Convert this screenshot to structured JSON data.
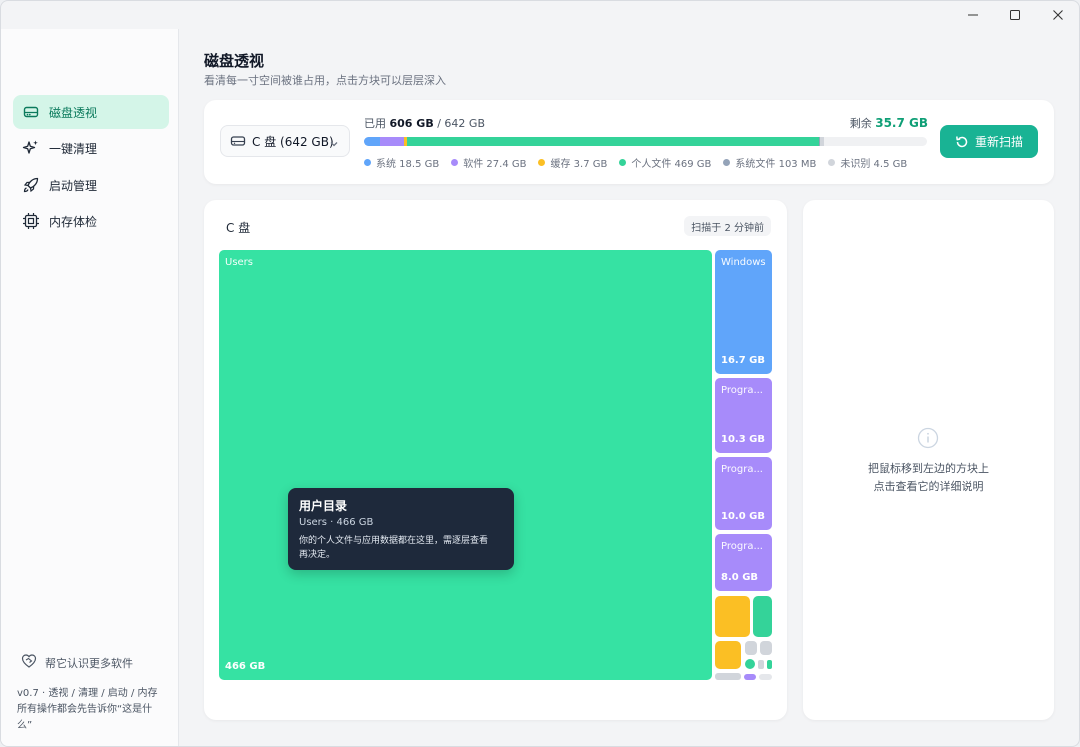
{
  "window_controls": {
    "minimize": "minimize",
    "maximize": "maximize",
    "close": "close"
  },
  "sidebar": {
    "items": [
      {
        "label": "磁盘透视",
        "icon": "drive-icon",
        "active": true
      },
      {
        "label": "一键清理",
        "icon": "sparkle-icon",
        "active": false
      },
      {
        "label": "启动管理",
        "icon": "rocket-icon",
        "active": false
      },
      {
        "label": "内存体检",
        "icon": "chip-icon",
        "active": false
      }
    ],
    "footer_link": "帮它认识更多软件",
    "version_line1": "v0.7 · 透视 / 清理 / 启动 / 内存",
    "version_line2": "所有操作都会先告诉你“这是什么”"
  },
  "header": {
    "title": "磁盘透视",
    "subtitle": "看清每一寸空间被谁占用，点击方块可以层层深入"
  },
  "drive": {
    "selected": "C 盘 (642 GB)",
    "used_label": "已用",
    "used": "606 GB",
    "total_sep": " / ",
    "total": "642 GB",
    "remain_label": "剩余",
    "remain": "35.7 GB",
    "rescan": "重新扫描",
    "breakdown": [
      {
        "label": "系统 18.5 GB",
        "value": 18.5,
        "color": "#60a5fa"
      },
      {
        "label": "软件 27.4 GB",
        "value": 27.4,
        "color": "#a78bfa"
      },
      {
        "label": "缓存 3.7 GB",
        "value": 3.7,
        "color": "#fbbf24"
      },
      {
        "label": "个人文件 469 GB",
        "value": 469,
        "color": "#34d399"
      },
      {
        "label": "系统文件 103 MB",
        "value": 0.103,
        "color": "#94a3b8"
      },
      {
        "label": "未识别 4.5 GB",
        "value": 4.5,
        "color": "#d1d5db"
      }
    ],
    "capacity": 642
  },
  "treemap": {
    "title": "C 盘",
    "scanned": "扫描于 2 分钟前",
    "tiles": [
      {
        "name": "Users",
        "size": "466 GB",
        "color": "#36e2a3"
      },
      {
        "name": "Windows",
        "size": "16.7 GB",
        "color": "#60a5fa"
      },
      {
        "name": "Progra...",
        "size": "10.3 GB",
        "color": "#a78bfa"
      },
      {
        "name": "Progra...",
        "size": "10.0 GB",
        "color": "#a78bfa"
      },
      {
        "name": "Progra...",
        "size": "8.0 GB",
        "color": "#a78bfa"
      }
    ],
    "tooltip": {
      "title": "用户目录",
      "subtitle": "Users · 466 GB",
      "desc1": "你的个人文件与应用数据都在这里，需逐层查看",
      "desc2": "再决定。"
    }
  },
  "detail": {
    "hint_line1": "把鼠标移到左边的方块上",
    "hint_line2": "点击查看它的详细说明"
  }
}
